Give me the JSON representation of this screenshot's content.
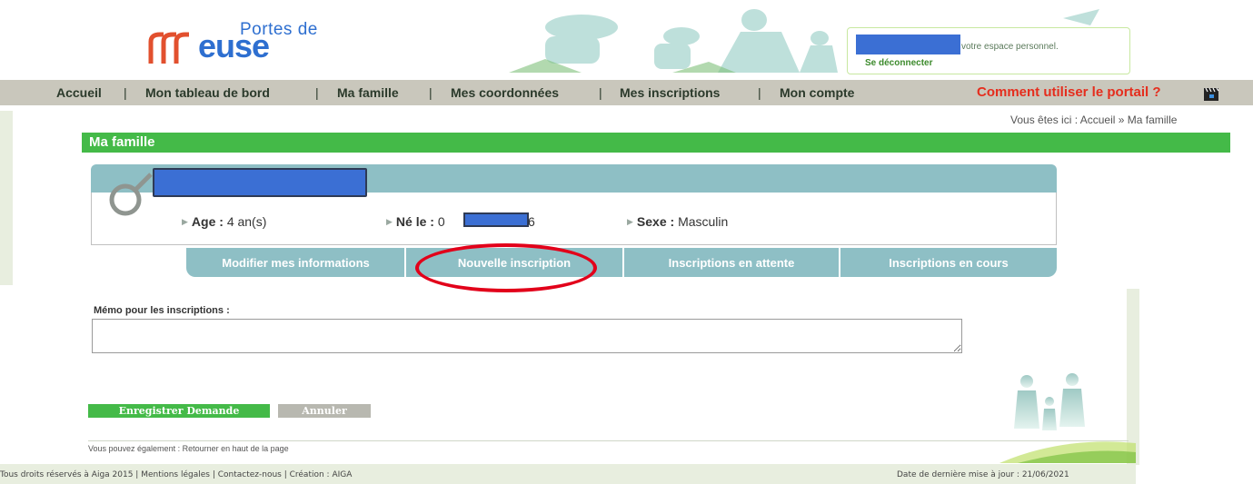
{
  "header": {
    "logo_top": "Portes de",
    "logo_main": "euse",
    "welcome_text": "votre espace personnel.",
    "logout_label": "Se déconnecter"
  },
  "nav": {
    "items": [
      "Accueil",
      "Mon tableau de bord",
      "Ma famille",
      "Mes coordonnées",
      "Mes inscriptions",
      "Mon compte"
    ],
    "separator": "|",
    "help_label": "Comment utiliser le portail ?"
  },
  "breadcrumb": "Vous êtes ici : Accueil » Ma famille",
  "section_title": "Ma famille",
  "child": {
    "age_label": "Age :",
    "age_value": "4 an(s)",
    "birth_label": "Né le :",
    "birth_prefix": "0",
    "birth_suffix": "6",
    "sex_label": "Sexe :",
    "sex_value": "Masculin"
  },
  "tabs": [
    "Modifier mes informations",
    "Nouvelle inscription",
    "Inscriptions en attente",
    "Inscriptions en cours"
  ],
  "memo": {
    "label": "Mémo pour les inscriptions :",
    "value": ""
  },
  "buttons": {
    "save": "Enregistrer Demande",
    "cancel": "Annuler"
  },
  "back_to_top": {
    "prefix": "Vous pouvez également :",
    "link": "Retourner en haut de la page"
  },
  "footer": {
    "left": "Tous droits réservés à Aiga 2015 | Mentions légales | Contactez-nous | Création : AIGA",
    "right": "Date de dernière mise à jour : 21/06/2021"
  },
  "colors": {
    "green": "#44ba48",
    "teal": "#8ebfc5",
    "red": "#e52d1d",
    "nav_bg": "#c9c7bc"
  }
}
